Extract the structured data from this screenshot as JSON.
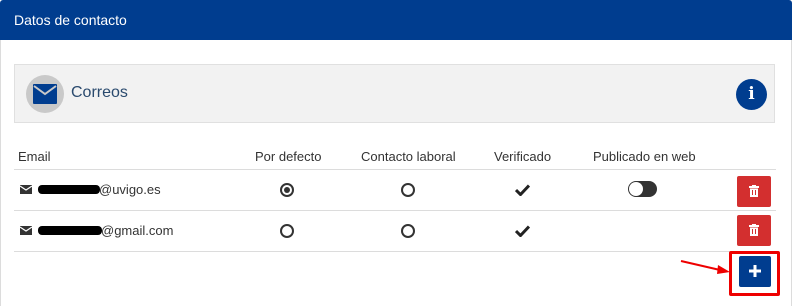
{
  "panel": {
    "title": "Datos de contacto"
  },
  "section": {
    "title": "Correos",
    "info_icon": "info-icon",
    "section_icon": "envelope-icon"
  },
  "table": {
    "columns": [
      "Email",
      "Por defecto",
      "Contacto laboral",
      "Verificado",
      "Publicado en web"
    ],
    "rows": [
      {
        "email_visible_part": "@uvigo.es",
        "por_defecto": true,
        "contacto_laboral": false,
        "verificado": true,
        "publicado_en_web": false
      },
      {
        "email_visible_part": "@gmail.com",
        "por_defecto": false,
        "contacto_laboral": false,
        "verificado": true,
        "publicado_en_web": null
      }
    ]
  },
  "actions": {
    "delete_icon": "trash-icon",
    "add_icon": "plus-icon"
  },
  "colors": {
    "primary": "#003d8f",
    "danger": "#d32f2f",
    "annotation": "#ee0000"
  }
}
